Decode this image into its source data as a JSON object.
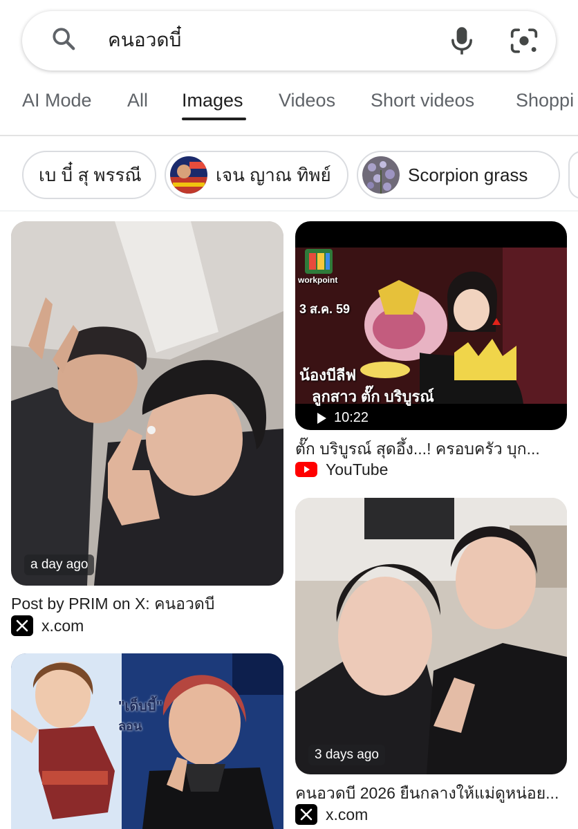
{
  "search": {
    "query": "คนอวดบี๋"
  },
  "tabs": [
    {
      "label": "AI Mode"
    },
    {
      "label": "All"
    },
    {
      "label": "Images"
    },
    {
      "label": "Videos"
    },
    {
      "label": "Short videos"
    },
    {
      "label": "Shoppi"
    }
  ],
  "active_tab": "Images",
  "chips": [
    {
      "label": "เบ บี๋ สุ พรรณี"
    },
    {
      "label": "เจน ญาณ ทิพย์"
    },
    {
      "label": "Scorpion grass"
    }
  ],
  "results": [
    {
      "time": "a day ago",
      "title": "Post by PRIM on X: คนอวดบี",
      "source": "x.com"
    },
    {
      "duration": "10:22",
      "overlay_date": "3 ส.ค. 59",
      "overlay_brand": "workpoint",
      "overlay_caption_1": "น้องบีลีฟ",
      "overlay_caption_2": "ลูกสาว ตั๊ก บริบูรณ์",
      "title": "ตั๊ก บริบูรณ์ สุดอึ้ง...! ครอบครัว บุก...",
      "source": "YouTube"
    },
    {
      "time": "3 days ago",
      "title": "คนอวดบี 2026 ยืนกลางให้แม่ดูหน่อย...",
      "source": "x.com"
    },
    {
      "overlay_text": "\"เด็บบี้\"",
      "overlay_sub": "ลอน"
    }
  ],
  "colors": {
    "accent": "#1f1f1f",
    "muted": "#5f6368",
    "youtube": "#ff0000"
  }
}
